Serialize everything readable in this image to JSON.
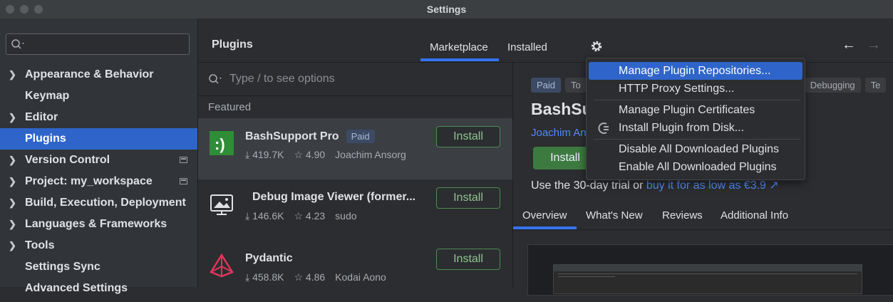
{
  "window": {
    "title": "Settings"
  },
  "sidebar": {
    "search_placeholder": "",
    "items": [
      {
        "label": "Appearance & Behavior",
        "chevron": true
      },
      {
        "label": "Keymap",
        "chevron": false
      },
      {
        "label": "Editor",
        "chevron": true
      },
      {
        "label": "Plugins",
        "chevron": false,
        "selected": true
      },
      {
        "label": "Version Control",
        "chevron": true,
        "project_icon": true
      },
      {
        "label": "Project: my_workspace",
        "chevron": true,
        "project_icon": true
      },
      {
        "label": "Build, Execution, Deployment",
        "chevron": true
      },
      {
        "label": "Languages & Frameworks",
        "chevron": true
      },
      {
        "label": "Tools",
        "chevron": true
      },
      {
        "label": "Settings Sync",
        "chevron": false
      },
      {
        "label": "Advanced Settings",
        "chevron": false
      }
    ]
  },
  "plugins": {
    "title": "Plugins",
    "tabs": {
      "marketplace": "Marketplace",
      "installed": "Installed"
    },
    "search_placeholder": "Type / to see options",
    "featured_label": "Featured",
    "list": [
      {
        "name": "BashSupport Pro",
        "badge": "Paid",
        "downloads": "419.7K",
        "rating": "4.90",
        "vendor": "Joachim Ansorg",
        "install_label": "Install"
      },
      {
        "name": "Debug Image Viewer (former...",
        "badge": "",
        "downloads": "146.6K",
        "rating": "4.23",
        "vendor": "sudo",
        "install_label": "Install"
      },
      {
        "name": "Pydantic",
        "badge": "",
        "downloads": "458.8K",
        "rating": "4.86",
        "vendor": "Kodai Aono",
        "install_label": "Install"
      }
    ]
  },
  "detail": {
    "tags": [
      "Paid",
      "To",
      "Debugging",
      "Te"
    ],
    "name": "BashSu",
    "vendor": "Joachim An",
    "install_label": "Install",
    "trial_text": "Use the 30-day trial or",
    "trial_link": "buy it for as low as €3.9 ↗",
    "tabs": [
      "Overview",
      "What's New",
      "Reviews",
      "Additional Info"
    ]
  },
  "dropdown": {
    "items": [
      {
        "label": "Manage Plugin Repositories...",
        "highlighted": true
      },
      {
        "label": "HTTP Proxy Settings..."
      },
      {
        "label": "Manage Plugin Certificates"
      },
      {
        "label": "Install Plugin from Disk..."
      },
      {
        "label": "Disable All Downloaded Plugins"
      },
      {
        "label": "Enable All Downloaded Plugins"
      }
    ]
  },
  "colors": {
    "accent": "#2f65ca",
    "link": "#548af7",
    "install_green": "#3d7a3f"
  }
}
